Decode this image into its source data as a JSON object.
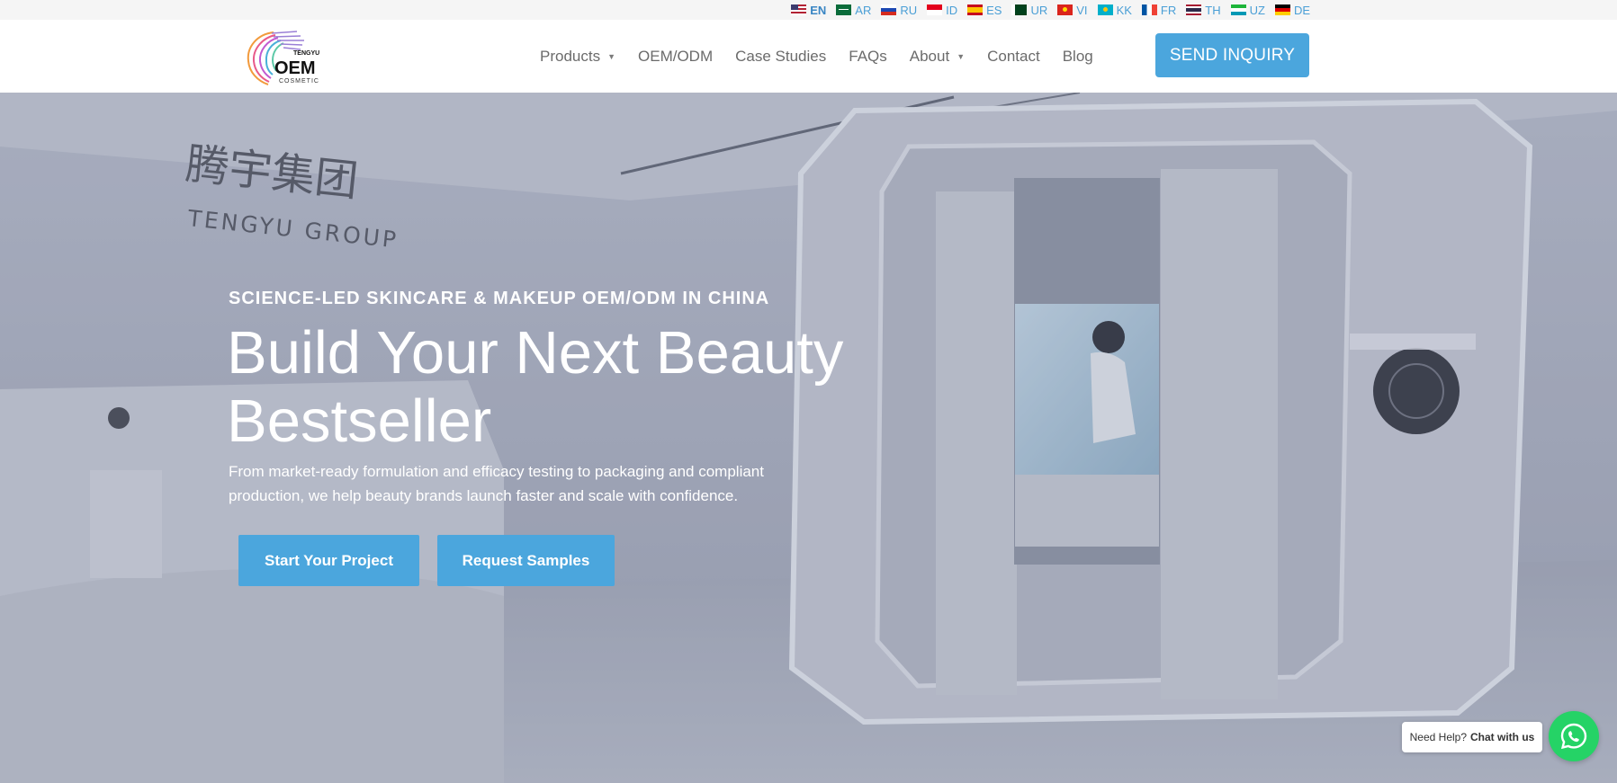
{
  "languages": [
    {
      "code": "EN",
      "flag": "us-flag",
      "active": true
    },
    {
      "code": "AR",
      "flag": "sa-flag"
    },
    {
      "code": "RU",
      "flag": "ru-flag"
    },
    {
      "code": "ID",
      "flag": "id-flag"
    },
    {
      "code": "ES",
      "flag": "es-flag"
    },
    {
      "code": "UR",
      "flag": "pk-flag"
    },
    {
      "code": "VI",
      "flag": "vn-flag"
    },
    {
      "code": "KK",
      "flag": "kz-flag"
    },
    {
      "code": "FR",
      "flag": "fr-flag"
    },
    {
      "code": "TH",
      "flag": "th-flag"
    },
    {
      "code": "UZ",
      "flag": "uz-flag"
    },
    {
      "code": "DE",
      "flag": "de-flag"
    }
  ],
  "brand": {
    "logo_top": "TENGYU",
    "logo_main": "OEM",
    "logo_sub": "COSMETIC"
  },
  "nav": {
    "items": [
      {
        "label": "Products",
        "dropdown": true
      },
      {
        "label": "OEM/ODM",
        "dropdown": false
      },
      {
        "label": "Case Studies",
        "dropdown": false
      },
      {
        "label": "FAQs",
        "dropdown": false
      },
      {
        "label": "About",
        "dropdown": true
      },
      {
        "label": "Contact",
        "dropdown": false
      },
      {
        "label": "Blog",
        "dropdown": false
      }
    ],
    "cta": "SEND INQUIRY"
  },
  "hero": {
    "eyebrow": "SCIENCE-LED SKINCARE & MAKEUP OEM/ODM IN CHINA",
    "headline": "Build Your Next Beauty Bestseller",
    "subtext": "From market-ready formulation and efficacy testing to packaging and compliant production, we help beauty brands launch faster and scale with confidence.",
    "primary_button": "Start Your Project",
    "secondary_button": "Request Samples",
    "sign_cn": "腾宇集团",
    "sign_en": "TENGYU GROUP"
  },
  "chat": {
    "prefix": "Need Help?",
    "action": "Chat with us",
    "icon": "whatsapp-icon"
  },
  "colors": {
    "accent": "#4ba6dd",
    "whatsapp": "#25d366"
  }
}
